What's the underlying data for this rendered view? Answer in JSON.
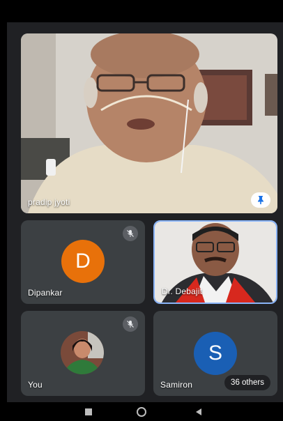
{
  "participants": {
    "main": {
      "name": "pradip jyoti"
    },
    "tiles": [
      {
        "name": "Dipankar",
        "initial": "D",
        "avatar_color": "#e8710a",
        "muted": true
      },
      {
        "name": "Dr. Debajit",
        "active_speaker": true
      },
      {
        "name": "You",
        "muted": true
      },
      {
        "name": "Samiron",
        "initial": "S",
        "avatar_color": "#1a5fb4"
      }
    ],
    "others_count": "36 others"
  },
  "colors": {
    "stage_bg": "#202124",
    "active_border": "#8ab4f8",
    "tile_bg": "#3c4043"
  },
  "icons": [
    "pin-icon",
    "mic-off-icon",
    "nav-recents-icon",
    "nav-home-icon",
    "nav-back-icon"
  ]
}
